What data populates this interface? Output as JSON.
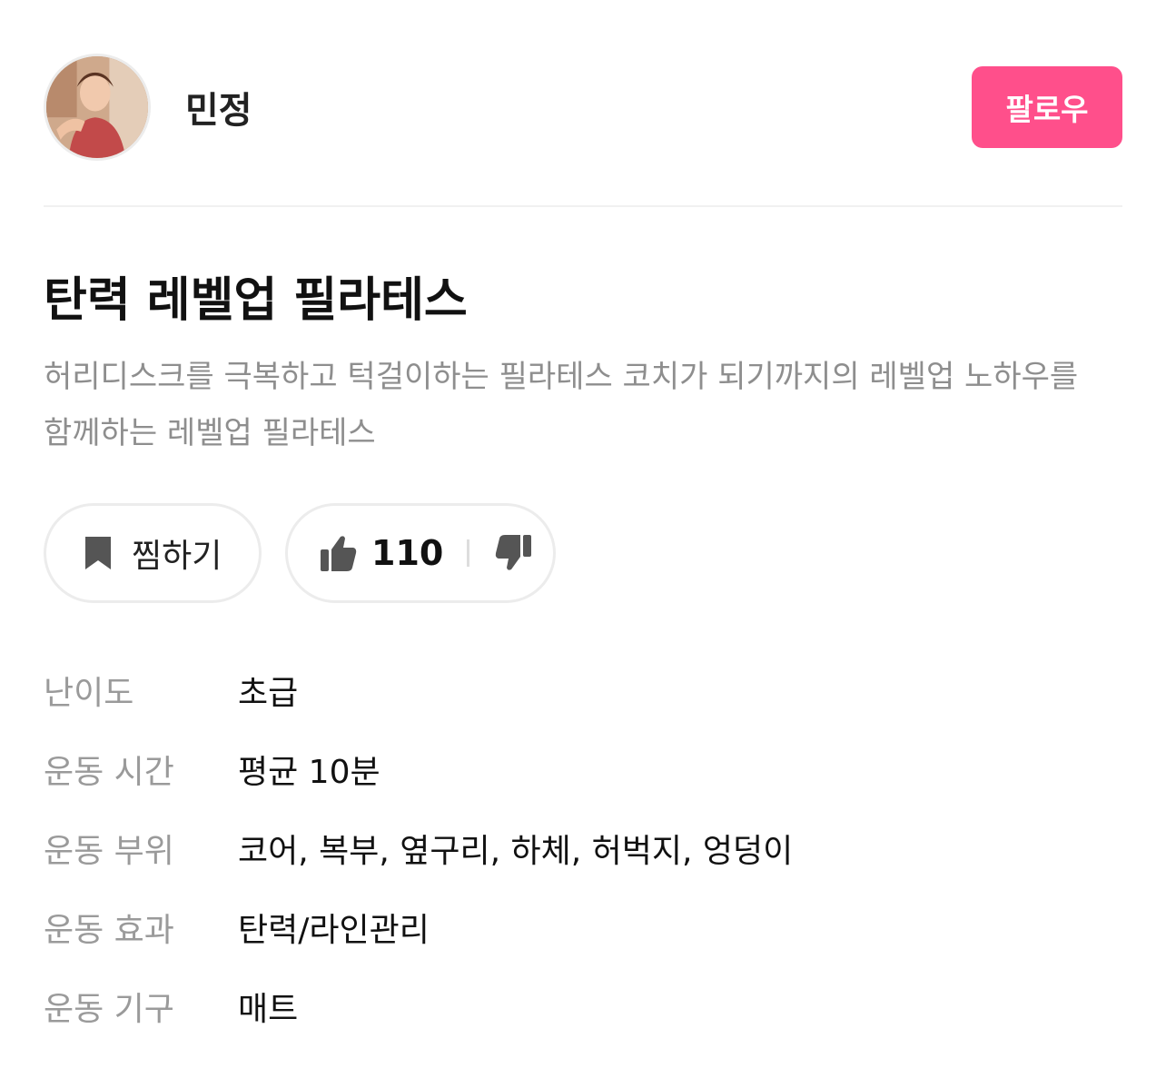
{
  "author": {
    "name": "민정",
    "follow_label": "팔로우"
  },
  "program": {
    "title": "탄력 레벨업 필라테스",
    "description": "허리디스크를 극복하고 턱걸이하는 필라테스 코치가 되기까지의 레벨업 노하우를 함께하는 레벨업 필라테스"
  },
  "actions": {
    "bookmark_label": "찜하기",
    "like_count": "110"
  },
  "info": [
    {
      "label": "난이도",
      "value": "초급"
    },
    {
      "label": "운동 시간",
      "value": "평균 10분"
    },
    {
      "label": "운동 부위",
      "value": "코어, 복부, 옆구리, 하체, 허벅지, 엉덩이"
    },
    {
      "label": "운동 효과",
      "value": "탄력/라인관리"
    },
    {
      "label": "운동 기구",
      "value": "매트"
    }
  ],
  "icons": {
    "bookmark": "bookmark-icon",
    "thumbs_up": "thumbs-up-icon",
    "thumbs_down": "thumbs-down-icon"
  },
  "colors": {
    "accent": "#ff4f8b",
    "icon_gray": "#555555",
    "muted_text": "#8e8e8e"
  }
}
